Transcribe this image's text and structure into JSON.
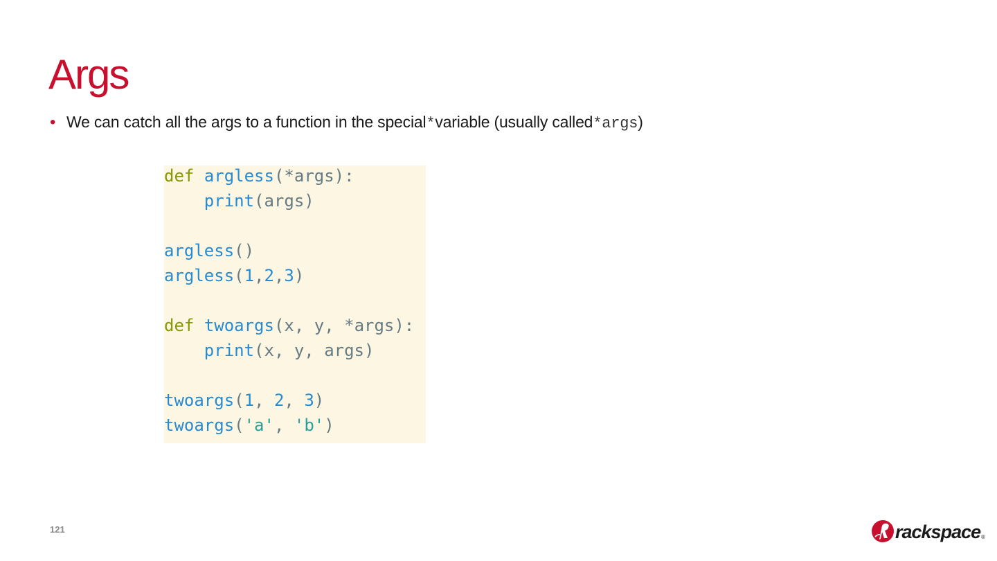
{
  "slide": {
    "title": "Args",
    "bullet": {
      "text_before": "We can catch all the args to a function in the special ",
      "code_star": "*",
      "text_middle": " variable (usually called ",
      "code_args": "*args",
      "text_after": ")"
    },
    "code_lines": [
      [
        {
          "t": "def",
          "c": "kw"
        },
        {
          "t": " ",
          "c": ""
        },
        {
          "t": "argless",
          "c": "fn"
        },
        {
          "t": "(*args):",
          "c": ""
        }
      ],
      [
        {
          "t": "    ",
          "c": ""
        },
        {
          "t": "print",
          "c": "fn"
        },
        {
          "t": "(args)",
          "c": ""
        }
      ],
      [],
      [
        {
          "t": "argless",
          "c": "fn"
        },
        {
          "t": "()",
          "c": ""
        }
      ],
      [
        {
          "t": "argless",
          "c": "fn"
        },
        {
          "t": "(",
          "c": ""
        },
        {
          "t": "1",
          "c": "fn"
        },
        {
          "t": ",",
          "c": ""
        },
        {
          "t": "2",
          "c": "fn"
        },
        {
          "t": ",",
          "c": ""
        },
        {
          "t": "3",
          "c": "fn"
        },
        {
          "t": ")",
          "c": ""
        }
      ],
      [],
      [
        {
          "t": "def",
          "c": "kw"
        },
        {
          "t": " ",
          "c": ""
        },
        {
          "t": "twoargs",
          "c": "fn"
        },
        {
          "t": "(x, y, *args):",
          "c": ""
        }
      ],
      [
        {
          "t": "    ",
          "c": ""
        },
        {
          "t": "print",
          "c": "fn"
        },
        {
          "t": "(x, y, args)",
          "c": ""
        }
      ],
      [],
      [
        {
          "t": "twoargs",
          "c": "fn"
        },
        {
          "t": "(",
          "c": ""
        },
        {
          "t": "1",
          "c": "fn"
        },
        {
          "t": ", ",
          "c": ""
        },
        {
          "t": "2",
          "c": "fn"
        },
        {
          "t": ", ",
          "c": ""
        },
        {
          "t": "3",
          "c": "fn"
        },
        {
          "t": ")",
          "c": ""
        }
      ],
      [
        {
          "t": "twoargs",
          "c": "fn"
        },
        {
          "t": "(",
          "c": ""
        },
        {
          "t": "'a'",
          "c": "str"
        },
        {
          "t": ", ",
          "c": ""
        },
        {
          "t": "'b'",
          "c": "str"
        },
        {
          "t": ")",
          "c": ""
        }
      ]
    ],
    "page_number": "121",
    "logo_text": "rackspace",
    "logo_registered": "®"
  },
  "colors": {
    "title": "#c8102e",
    "code_background": "#fdf6e3",
    "code_keyword": "#859900",
    "code_function": "#268bd2",
    "code_string": "#2aa198",
    "code_default": "#657b83"
  }
}
